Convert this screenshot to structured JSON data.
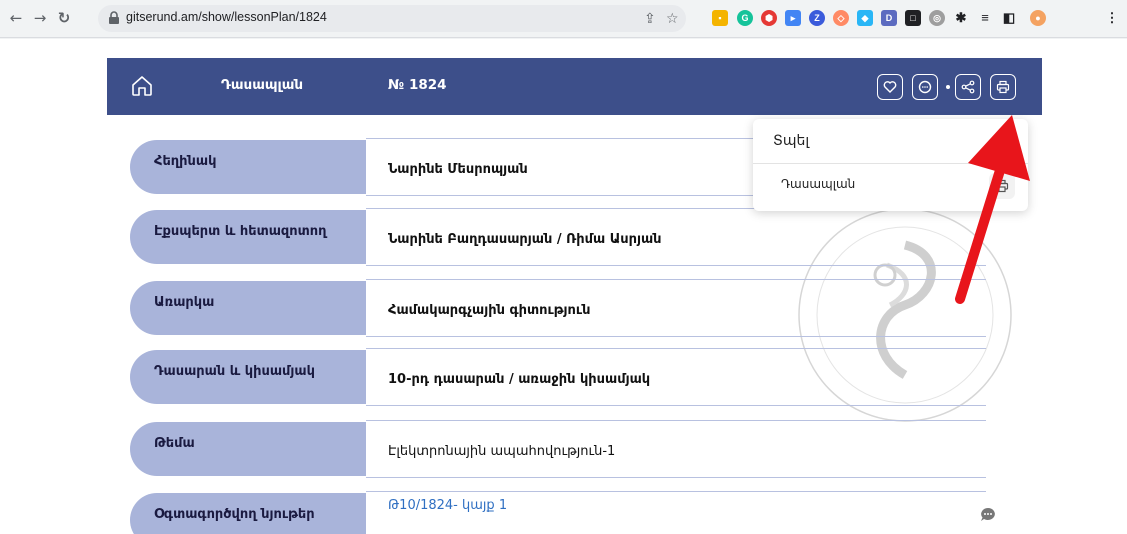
{
  "browser": {
    "url": "gitserund.am/show/lessonPlan/1824"
  },
  "header": {
    "title": "Դասապլան",
    "number": "№ 1824"
  },
  "rows": [
    {
      "label": "Հեղինակ",
      "value": "Նարինե Մեսրոպյան"
    },
    {
      "label": "Էքսպերտ և հետազոտող",
      "value": "Նարինե Բաղդասարյան / Ռիմա Ասրյան"
    },
    {
      "label": "Առարկա",
      "value": "Համակարգչային գիտություն"
    },
    {
      "label": "Դասարան և կիսամյակ",
      "value": "10-րդ դասարան / առաջին կիսամյակ"
    },
    {
      "label": "Թեմա",
      "value": "Էլեկտրոնային ապահովություն-1"
    },
    {
      "label": "Օգտագործվող նյութեր",
      "value": "Թ10/1824- կայք 1"
    }
  ],
  "print_menu": {
    "title": "Տպել",
    "item": "Դասապլան"
  },
  "colors": {
    "header": "#3d4f8a",
    "label_bg": "#a9b4da",
    "arrow": "#e8151b"
  }
}
